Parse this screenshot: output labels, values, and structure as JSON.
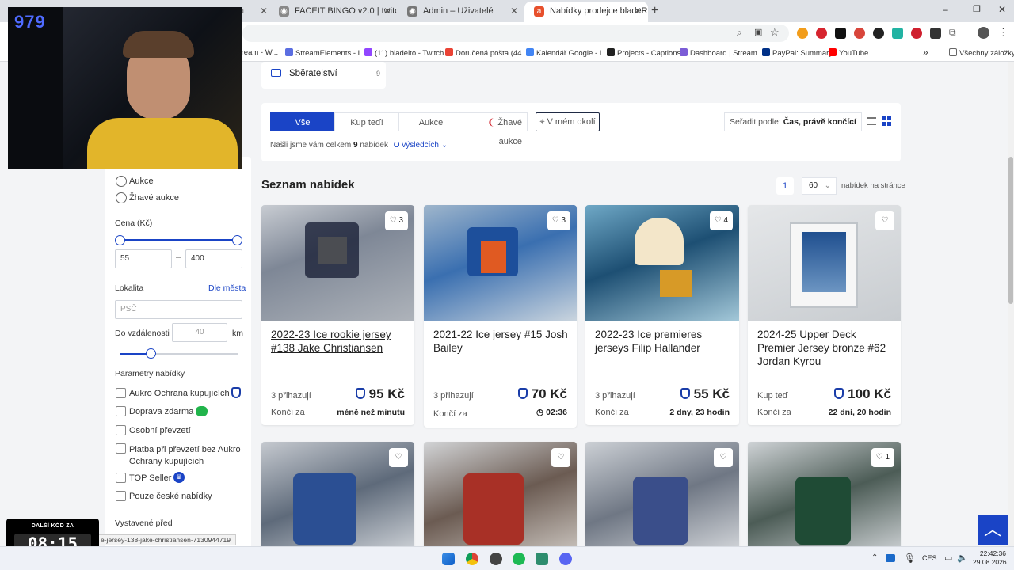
{
  "overlay": {
    "counter": "979",
    "timer_label": "DALŠÍ KÓD ZA",
    "timer_value": "08:15"
  },
  "browser": {
    "tabs": [
      {
        "label": "FACEIT BINGO v2.0 | twitch.tv/..."
      },
      {
        "label": "Admin – Uživatelé"
      },
      {
        "label": "Nabídky prodejce bladeRP | Au"
      }
    ],
    "bookmarks": [
      "tream - W...",
      "StreamElements - L...",
      "(11) bladeito - Twitch",
      "Doručená pošta (44...",
      "Kalendář Google - I...",
      "Projects - Captions",
      "Dashboard | Stream...",
      "PayPal: Summary",
      "YouTube",
      "Všechny záložky"
    ],
    "status_url": "e-jersey-138-jake-christiansen-7130944719"
  },
  "category": {
    "label": "Sběratelství",
    "count": "9"
  },
  "tabs_filter": {
    "all": "Vše",
    "buy_now": "Kup teď!",
    "auction": "Aukce",
    "hot": "Žhavé aukce",
    "nearby": "V mém okolí"
  },
  "sort": {
    "label": "Seřadit podle:",
    "value": "Čas, právě končící"
  },
  "results": {
    "prefix": "Našli jsme vám celkem",
    "count": "9",
    "suffix": "nabídek",
    "about": "O výsledcích"
  },
  "list": {
    "title": "Seznam nabídek",
    "page": "1",
    "per_page": "60",
    "per_page_label": "nabídek na stránce"
  },
  "sidebar": {
    "radios": [
      "Aukce",
      "Žhavé aukce"
    ],
    "price_label": "Cena (Kč)",
    "price_min": "55",
    "price_max": "400",
    "price_dash": "–",
    "location_label": "Lokalita",
    "by_city": "Dle města",
    "zip_placeholder": "PSČ",
    "distance_label": "Do vzdálenosti",
    "distance_value": "40",
    "distance_unit": "km",
    "params_label": "Parametry nabídky",
    "params": [
      "Aukro Ochrana kupujících",
      "Doprava zdarma",
      "Osobní převzetí",
      "Platba při převzetí bez Aukro Ochrany kupujících",
      "TOP Seller",
      "Pouze české nabídky"
    ],
    "posted_label": "Vystavené před"
  },
  "offers": [
    {
      "title": "2022-23 Ice rookie jersey #138 Jake Christiansen",
      "likes": "3",
      "bids": "3 přihazují",
      "price": "95 Kč",
      "ends_label": "Končí za",
      "ends": "méně než minutu"
    },
    {
      "title": "2021-22 Ice jersey #15 Josh Bailey",
      "likes": "3",
      "bids": "3 přihazují",
      "price": "70 Kč",
      "ends_label": "Končí za",
      "ends": "02:36"
    },
    {
      "title": "2022-23 Ice premieres jerseys Filip Hallander",
      "likes": "4",
      "bids": "3 přihazují",
      "price": "55 Kč",
      "ends_label": "Končí za",
      "ends": "2 dny, 23 hodin"
    },
    {
      "title": "2024-25 Upper Deck Premier Jersey bronze #62 Jordan Kyrou",
      "likes": "",
      "bids": "Kup teď",
      "price": "100 Kč",
      "ends_label": "Končí za",
      "ends": "22 dní, 20 hodin"
    },
    {
      "likes": ""
    },
    {
      "likes": ""
    },
    {
      "likes": ""
    },
    {
      "likes": "1"
    }
  ],
  "taskbar": {
    "lang": "CES",
    "time": "22:42:36",
    "date": "29.08.2026"
  },
  "colors": {
    "accent": "#1a44c6",
    "hot": "#d0212b"
  }
}
